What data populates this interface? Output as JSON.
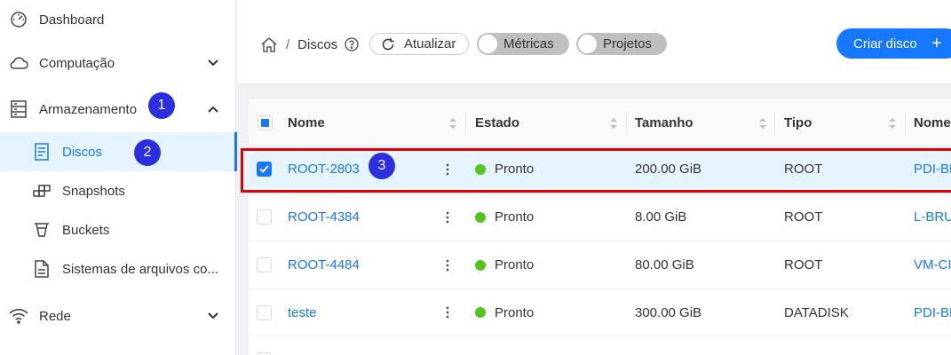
{
  "sidebar": {
    "items": [
      {
        "label": "Dashboard",
        "icon": "dashboard-icon"
      },
      {
        "label": "Computação",
        "icon": "cloud-icon",
        "expanded": false
      },
      {
        "label": "Armazenamento",
        "icon": "storage-icon",
        "expanded": true
      },
      {
        "label": "Rede",
        "icon": "wifi-icon",
        "expanded": false
      }
    ],
    "storage_children": [
      {
        "label": "Discos",
        "icon": "disk-icon",
        "active": true
      },
      {
        "label": "Snapshots",
        "icon": "snapshot-icon"
      },
      {
        "label": "Buckets",
        "icon": "bucket-icon"
      },
      {
        "label": "Sistemas de arquivos co...",
        "icon": "file-icon"
      }
    ]
  },
  "annotations": [
    "1",
    "2",
    "3"
  ],
  "header": {
    "breadcrumb_separator": "/",
    "breadcrumb_current": "Discos",
    "refresh_label": "Atualizar",
    "metrics_label": "Métricas",
    "projects_label": "Projetos",
    "create_label": "Criar disco",
    "create_icon": "+"
  },
  "table": {
    "columns": [
      "Nome",
      "Estado",
      "Tamanho",
      "Tipo",
      "Nome"
    ],
    "rows": [
      {
        "name": "ROOT-2803",
        "state": "Pronto",
        "size": "200.00 GiB",
        "type": "ROOT",
        "vm": "PDI-BF",
        "selected": true
      },
      {
        "name": "ROOT-4384",
        "state": "Pronto",
        "size": "8.00 GiB",
        "type": "ROOT",
        "vm": "L-BRU",
        "selected": false
      },
      {
        "name": "ROOT-4484",
        "state": "Pronto",
        "size": "80.00 GiB",
        "type": "ROOT",
        "vm": "VM-CI",
        "selected": false
      },
      {
        "name": "teste",
        "state": "Pronto",
        "size": "300.00 GiB",
        "type": "DATADISK",
        "vm": "PDI-BF",
        "selected": false
      }
    ]
  },
  "colors": {
    "accent": "#1677ff",
    "status_ready": "#52c41a",
    "annotation": "#2b2fe0",
    "highlight": "#e00000"
  }
}
